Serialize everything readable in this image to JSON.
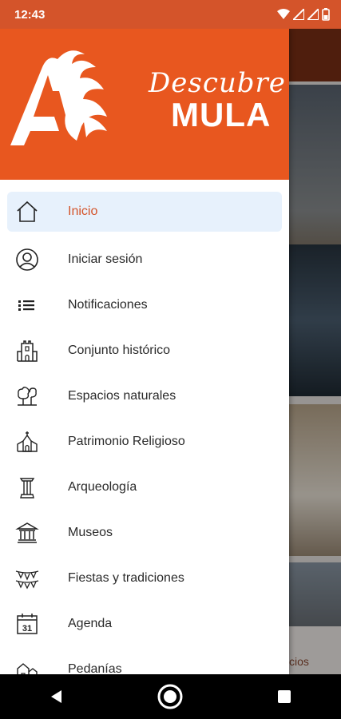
{
  "status_bar": {
    "time": "12:43"
  },
  "drawer": {
    "brand": {
      "script": "Descubre",
      "name": "MULA"
    },
    "menu": [
      {
        "label": "Inicio",
        "icon": "home-icon",
        "active": true
      },
      {
        "label": "Iniciar sesión",
        "icon": "user-circle-icon"
      },
      {
        "label": "Notificaciones",
        "icon": "list-icon"
      },
      {
        "label": "Conjunto histórico",
        "icon": "castle-icon"
      },
      {
        "label": "Espacios naturales",
        "icon": "trees-icon"
      },
      {
        "label": "Patrimonio Religioso",
        "icon": "church-icon"
      },
      {
        "label": "Arqueología",
        "icon": "column-icon"
      },
      {
        "label": "Museos",
        "icon": "museum-icon"
      },
      {
        "label": "Fiestas y tradiciones",
        "icon": "bunting-icon"
      },
      {
        "label": "Agenda",
        "icon": "calendar-icon",
        "calendar_day": "31"
      },
      {
        "label": "Pedanías",
        "icon": "village-icon"
      }
    ]
  },
  "background": {
    "bottom_tab_partial": "cios"
  },
  "colors": {
    "brand": "#e8571f",
    "status_bar": "#d4542a",
    "active_bg": "#e7f1fc",
    "active_text": "#d4542a"
  }
}
